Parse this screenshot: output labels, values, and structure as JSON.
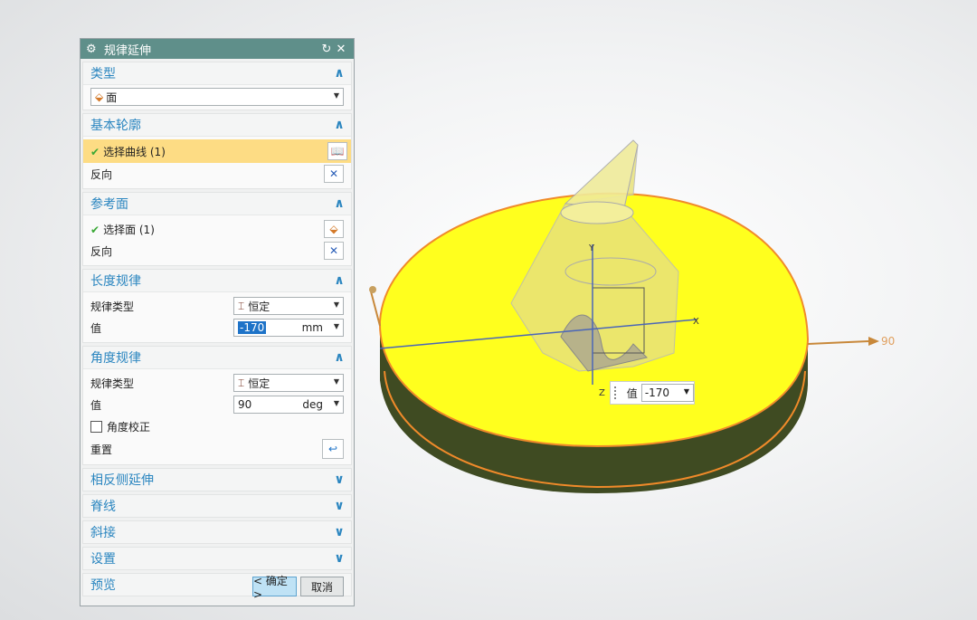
{
  "dialog": {
    "title": "规律延伸",
    "type_section": {
      "header": "类型",
      "selected": "面"
    },
    "base_profile": {
      "header": "基本轮廓",
      "select_curve": "选择曲线 (1)",
      "reverse": "反向"
    },
    "reference_face": {
      "header": "参考面",
      "select_face": "选择面 (1)",
      "reverse": "反向"
    },
    "length_law": {
      "header": "长度规律",
      "law_type_label": "规律类型",
      "law_type": "恒定",
      "value_label": "值",
      "value": "-170",
      "unit": "mm"
    },
    "angle_law": {
      "header": "角度规律",
      "law_type_label": "规律类型",
      "law_type": "恒定",
      "value_label": "值",
      "value": "90",
      "unit": "deg",
      "angle_correction": "角度校正",
      "reset": "重置"
    },
    "collapsed_sections": [
      "相反侧延伸",
      "脊线",
      "斜接",
      "设置",
      "预览"
    ],
    "ok_button": "< 确定 >",
    "cancel_button": "取消"
  },
  "viewport": {
    "angle_readout": "90",
    "axis_x": "X",
    "axis_y": "Y",
    "axis_z": "Z",
    "value_popup": {
      "label": "值",
      "value": "-170"
    }
  },
  "colors": {
    "title_bar": "#5f8f8a",
    "section_header": "#2b86c0",
    "selection_highlight": "#fddc84",
    "disc_top": "#ffff1e",
    "disc_side": "#3e4a22",
    "edge": "#f08a2a"
  }
}
